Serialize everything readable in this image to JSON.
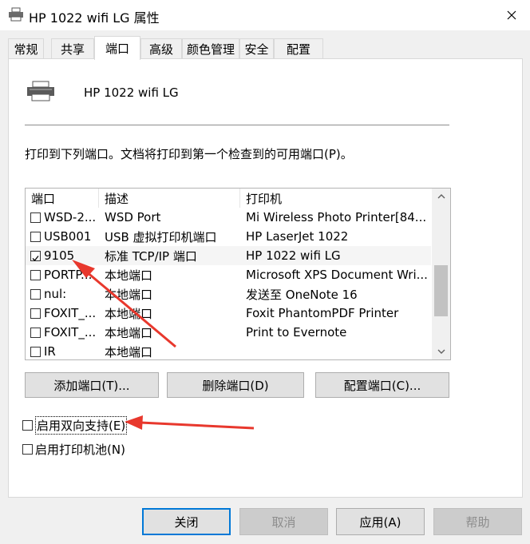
{
  "window": {
    "title": "HP 1022 wifi LG 属性",
    "close_icon": "close-icon"
  },
  "tabs": [
    {
      "label": "常规",
      "active": false
    },
    {
      "label": "共享",
      "active": false
    },
    {
      "label": "端口",
      "active": true
    },
    {
      "label": "高级",
      "active": false
    },
    {
      "label": "颜色管理",
      "active": false
    },
    {
      "label": "安全",
      "active": false
    },
    {
      "label": "配置",
      "active": false
    }
  ],
  "ports_page": {
    "printer_name": "HP 1022 wifi LG",
    "printer_icon": "printer-icon",
    "instruction": "打印到下列端口。文档将打印到第一个检查到的可用端口(P)。",
    "columns": [
      "端口",
      "描述",
      "打印机"
    ],
    "rows": [
      {
        "port": "WSD-2...",
        "desc": "WSD Port",
        "printer": "Mi Wireless Photo Printer[84...",
        "checked": false
      },
      {
        "port": "USB001",
        "desc": "USB 虚拟打印机端口",
        "printer": "HP LaserJet 1022",
        "checked": false
      },
      {
        "port": "9105",
        "desc": "标准 TCP/IP 端口",
        "printer": "HP 1022 wifi LG",
        "checked": true
      },
      {
        "port": "PORTP...",
        "desc": "本地端口",
        "printer": "Microsoft XPS Document Wri...",
        "checked": false
      },
      {
        "port": "nul:",
        "desc": "本地端口",
        "printer": "发送至 OneNote 16",
        "checked": false
      },
      {
        "port": "FOXIT_...",
        "desc": "本地端口",
        "printer": "Foxit PhantomPDF Printer",
        "checked": false
      },
      {
        "port": "FOXIT_...",
        "desc": "本地端口",
        "printer": "Print to Evernote",
        "checked": false
      },
      {
        "port": "IR",
        "desc": "本地端口",
        "printer": "",
        "checked": false
      }
    ],
    "buttons": {
      "add_port": "添加端口(T)...",
      "delete_port": "删除端口(D)",
      "configure_port": "配置端口(C)..."
    },
    "bidirectional": {
      "label": "启用双向支持(E)",
      "checked": false
    },
    "pooling": {
      "label": "启用打印机池(N)",
      "checked": false
    }
  },
  "footer": {
    "ok": "关闭",
    "cancel": "取消",
    "apply": "应用(A)",
    "help": "帮助"
  },
  "colors": {
    "annotation_arrow": "#e8382d",
    "default_button_border": "#0078d7"
  }
}
